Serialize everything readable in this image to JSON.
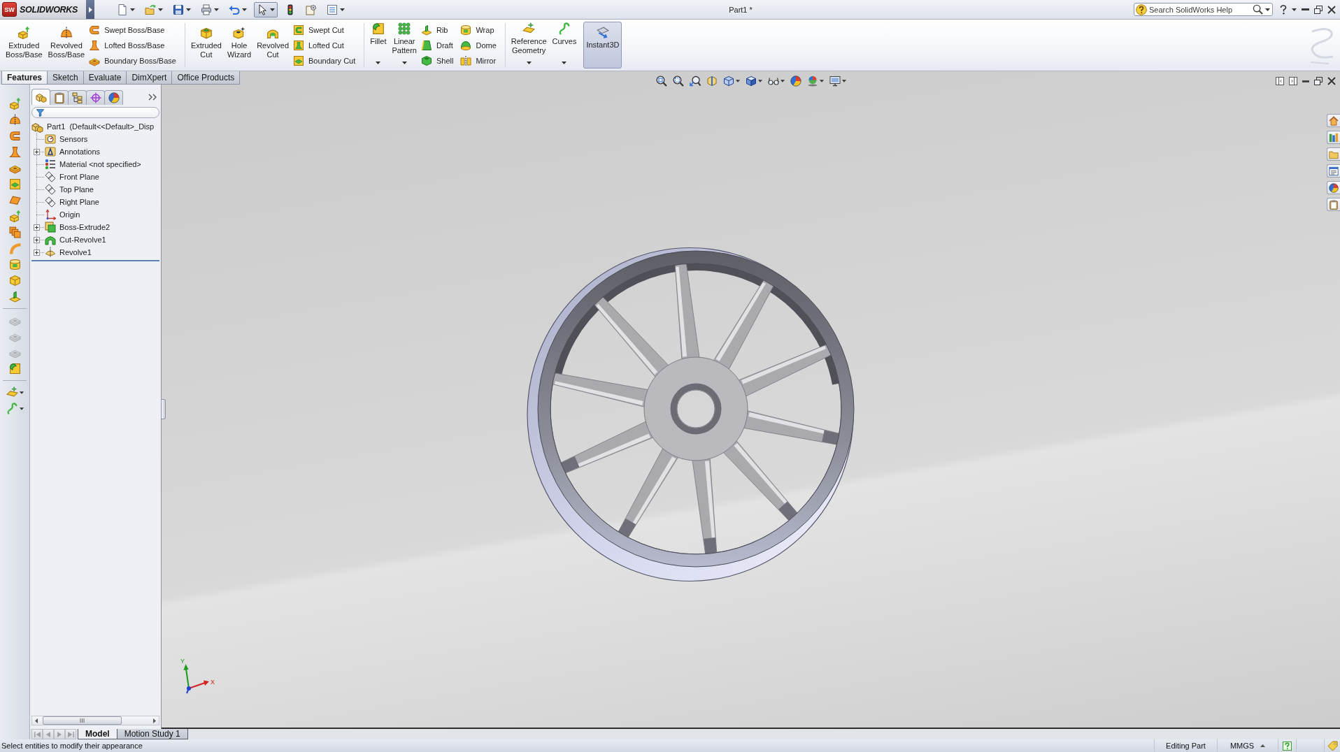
{
  "title_bar": {
    "logo_mark": "SW",
    "logo_name": "SOLIDWORKS",
    "quick_access": [
      {
        "dropdown": true,
        "pressed": false
      },
      {
        "dropdown": true,
        "pressed": false
      },
      {
        "dropdown": true,
        "pressed": false
      },
      {
        "dropdown": true,
        "pressed": false
      },
      {
        "dropdown": true,
        "pressed": false
      },
      {
        "dropdown": true,
        "pressed": true
      },
      {
        "dropdown": false,
        "pressed": false
      },
      {
        "dropdown": false,
        "pressed": false
      },
      {
        "dropdown": true,
        "pressed": false
      }
    ],
    "document_title": "Part1 *",
    "search": {
      "placeholder": "Search SolidWorks Help"
    }
  },
  "command_manager": {
    "groups": [
      {
        "items": [
          {
            "kind": "large",
            "label": "Extruded Boss/Base",
            "dropdown": false,
            "pressed": false
          },
          {
            "kind": "large",
            "label": "Revolved Boss/Base",
            "dropdown": false,
            "pressed": false
          },
          {
            "kind": "stack",
            "labels": [
              "Swept Boss/Base",
              "Lofted Boss/Base",
              "Boundary Boss/Base"
            ]
          }
        ]
      },
      {
        "items": [
          {
            "kind": "large",
            "label": "Extruded Cut",
            "dropdown": false,
            "pressed": false
          },
          {
            "kind": "large",
            "label": "Hole Wizard",
            "dropdown": false,
            "pressed": false
          },
          {
            "kind": "large",
            "label": "Revolved Cut",
            "dropdown": false,
            "pressed": false
          },
          {
            "kind": "stack",
            "labels": [
              "Swept Cut",
              "Lofted Cut",
              "Boundary Cut"
            ]
          }
        ]
      },
      {
        "items": [
          {
            "kind": "large",
            "label": "Fillet",
            "dropdown": true,
            "pressed": false
          },
          {
            "kind": "large",
            "label": "Linear Pattern",
            "dropdown": true,
            "pressed": false
          },
          {
            "kind": "stack",
            "labels": [
              "Rib",
              "Draft",
              "Shell"
            ]
          },
          {
            "kind": "stack",
            "labels": [
              "Wrap",
              "Dome",
              "Mirror"
            ]
          }
        ]
      },
      {
        "items": [
          {
            "kind": "large",
            "label": "Reference Geometry",
            "dropdown": true,
            "pressed": false
          },
          {
            "kind": "large",
            "label": "Curves",
            "dropdown": true,
            "pressed": false
          },
          {
            "kind": "large",
            "label": "Instant3D",
            "dropdown": false,
            "pressed": true
          }
        ]
      }
    ],
    "tabs": [
      {
        "label": "Features",
        "selected": true
      },
      {
        "label": "Sketch",
        "selected": false
      },
      {
        "label": "Evaluate",
        "selected": false
      },
      {
        "label": "DimXpert",
        "selected": false
      },
      {
        "label": "Office Products",
        "selected": false
      }
    ]
  },
  "left_toolbar": {
    "groups": [
      {
        "buttons": [
          {
            "disabled": false,
            "dropdown": false
          },
          {
            "disabled": false,
            "dropdown": false
          },
          {
            "disabled": false,
            "dropdown": false
          },
          {
            "disabled": false,
            "dropdown": false
          },
          {
            "disabled": false,
            "dropdown": false
          },
          {
            "disabled": false,
            "dropdown": false
          },
          {
            "disabled": false,
            "dropdown": false
          },
          {
            "disabled": false,
            "dropdown": false
          },
          {
            "disabled": false,
            "dropdown": false
          },
          {
            "disabled": false,
            "dropdown": false
          },
          {
            "disabled": false,
            "dropdown": false
          },
          {
            "disabled": false,
            "dropdown": false
          },
          {
            "disabled": false,
            "dropdown": false
          }
        ]
      },
      {
        "buttons": [
          {
            "disabled": true,
            "dropdown": false
          },
          {
            "disabled": true,
            "dropdown": false
          },
          {
            "disabled": true,
            "dropdown": false
          },
          {
            "disabled": false,
            "dropdown": false
          }
        ]
      },
      {
        "buttons": [
          {
            "disabled": false,
            "dropdown": true
          },
          {
            "disabled": false,
            "dropdown": true
          }
        ]
      }
    ]
  },
  "feature_manager": {
    "panel_tabs": [
      {
        "selected": true
      },
      {
        "selected": false
      },
      {
        "selected": false
      },
      {
        "selected": false
      },
      {
        "selected": false
      }
    ],
    "tree": {
      "label": "Part1  (Default<<Default>_Disp",
      "children": [
        {
          "label": "Sensors",
          "expander": false
        },
        {
          "label": "Annotations",
          "expander": true
        },
        {
          "label": "Material <not specified>",
          "expander": false
        },
        {
          "label": "Front Plane",
          "expander": false
        },
        {
          "label": "Top Plane",
          "expander": false
        },
        {
          "label": "Right Plane",
          "expander": false
        },
        {
          "label": "Origin",
          "expander": false
        },
        {
          "label": "Boss-Extrude2",
          "expander": true
        },
        {
          "label": "Cut-Revolve1",
          "expander": true
        },
        {
          "label": "Revolve1",
          "expander": true
        }
      ]
    }
  },
  "graphics_area": {
    "view_toolbar": [
      {
        "dropdown": false
      },
      {
        "dropdown": false
      },
      {
        "dropdown": false
      },
      {
        "dropdown": false
      },
      {
        "dropdown": true
      },
      {
        "dropdown": true
      },
      {
        "dropdown": true
      },
      {
        "dropdown": false
      },
      {
        "dropdown": true
      },
      {
        "dropdown": true
      }
    ],
    "triad": {
      "y_label": "Y",
      "x_label": "X"
    }
  },
  "bottom_tabs": {
    "nav_buttons": [
      {
        "disabled": true
      },
      {
        "disabled": true
      },
      {
        "disabled": true
      },
      {
        "disabled": true
      }
    ],
    "tabs": [
      {
        "label": "Model",
        "selected": true
      },
      {
        "label": "Motion Study 1",
        "selected": false
      }
    ]
  },
  "status_bar": {
    "message": "Select entities to modify their appearance",
    "mode": "Editing Part",
    "units": "MMGS"
  }
}
